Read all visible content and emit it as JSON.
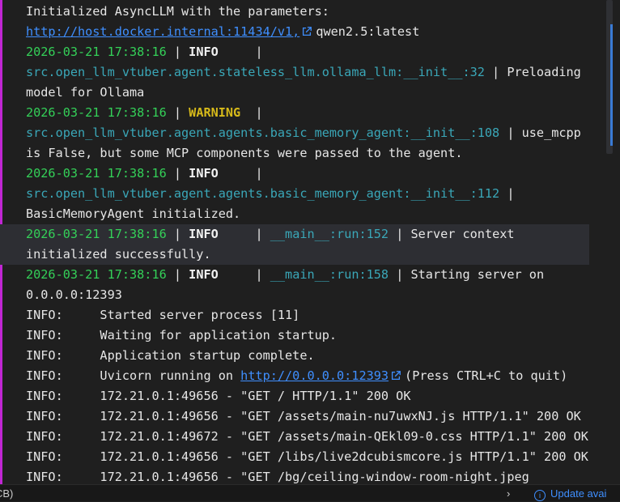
{
  "terminal": {
    "lines": [
      {
        "parts": [
          {
            "t": "text",
            "v": "Initialized AsyncLLM with the parameters:"
          }
        ]
      },
      {
        "parts": [
          {
            "t": "link",
            "v": "http://host.docker.internal:11434/v1,"
          },
          {
            "t": "text",
            "v": "qwen2.5:latest"
          }
        ]
      },
      {
        "parts": [
          {
            "t": "ts",
            "v": "2026-03-21 17:38:16"
          },
          {
            "t": "text",
            "v": " | "
          },
          {
            "t": "info",
            "v": "INFO    "
          },
          {
            "t": "text",
            "v": " |"
          }
        ]
      },
      {
        "parts": [
          {
            "t": "mod",
            "v": "src.open_llm_vtuber.agent.stateless_llm.ollama_llm:__init__:32"
          },
          {
            "t": "text",
            "v": " | Preloading"
          }
        ]
      },
      {
        "parts": [
          {
            "t": "text",
            "v": "model for Ollama"
          }
        ]
      },
      {
        "parts": [
          {
            "t": "ts",
            "v": "2026-03-21 17:38:16"
          },
          {
            "t": "text",
            "v": " | "
          },
          {
            "t": "warn",
            "v": "WARNING "
          },
          {
            "t": "text",
            "v": " |"
          }
        ]
      },
      {
        "parts": [
          {
            "t": "mod",
            "v": "src.open_llm_vtuber.agent.agents.basic_memory_agent:__init__:108"
          },
          {
            "t": "text",
            "v": " | use_mcpp"
          }
        ]
      },
      {
        "parts": [
          {
            "t": "text",
            "v": "is False, but some MCP components were passed to the agent."
          }
        ]
      },
      {
        "parts": [
          {
            "t": "ts",
            "v": "2026-03-21 17:38:16"
          },
          {
            "t": "text",
            "v": " | "
          },
          {
            "t": "info",
            "v": "INFO    "
          },
          {
            "t": "text",
            "v": " |"
          }
        ]
      },
      {
        "parts": [
          {
            "t": "mod",
            "v": "src.open_llm_vtuber.agent.agents.basic_memory_agent:__init__:112"
          },
          {
            "t": "text",
            "v": " |"
          }
        ]
      },
      {
        "parts": [
          {
            "t": "text",
            "v": "BasicMemoryAgent initialized."
          }
        ]
      },
      {
        "hl": true,
        "parts": [
          {
            "t": "ts",
            "v": "2026-03-21 17:38:16"
          },
          {
            "t": "text",
            "v": " | "
          },
          {
            "t": "info",
            "v": "INFO    "
          },
          {
            "t": "text",
            "v": " | "
          },
          {
            "t": "mod",
            "v": "__main__:run:152"
          },
          {
            "t": "text",
            "v": " | Server context"
          }
        ]
      },
      {
        "hl": true,
        "parts": [
          {
            "t": "text",
            "v": "initialized successfully."
          }
        ]
      },
      {
        "parts": [
          {
            "t": "ts",
            "v": "2026-03-21 17:38:16"
          },
          {
            "t": "text",
            "v": " | "
          },
          {
            "t": "info",
            "v": "INFO    "
          },
          {
            "t": "text",
            "v": " | "
          },
          {
            "t": "mod",
            "v": "__main__:run:158"
          },
          {
            "t": "text",
            "v": " | Starting server on"
          }
        ]
      },
      {
        "parts": [
          {
            "t": "text",
            "v": "0.0.0.0:12393"
          }
        ]
      },
      {
        "parts": [
          {
            "t": "text",
            "v": "INFO:     Started server process [11]"
          }
        ]
      },
      {
        "parts": [
          {
            "t": "text",
            "v": "INFO:     Waiting for application startup."
          }
        ]
      },
      {
        "parts": [
          {
            "t": "text",
            "v": "INFO:     Application startup complete."
          }
        ]
      },
      {
        "parts": [
          {
            "t": "text",
            "v": "INFO:     Uvicorn running on "
          },
          {
            "t": "link",
            "v": "http://0.0.0.0:12393"
          },
          {
            "t": "text",
            "v": "(Press CTRL+C to quit)"
          }
        ]
      },
      {
        "parts": [
          {
            "t": "text",
            "v": "INFO:     172.21.0.1:49656 - \"GET / HTTP/1.1\" 200 OK"
          }
        ]
      },
      {
        "parts": [
          {
            "t": "text",
            "v": "INFO:     172.21.0.1:49656 - \"GET /assets/main-nu7uwxNJ.js HTTP/1.1\" 200 OK"
          }
        ]
      },
      {
        "parts": [
          {
            "t": "text",
            "v": "INFO:     172.21.0.1:49672 - \"GET /assets/main-QEkl09-0.css HTTP/1.1\" 200 OK"
          }
        ]
      },
      {
        "parts": [
          {
            "t": "text",
            "v": "INFO:     172.21.0.1:49656 - \"GET /libs/live2dcubismcore.js HTTP/1.1\" 200 OK"
          }
        ]
      },
      {
        "parts": [
          {
            "t": "text",
            "v": "INFO:     172.21.0.1:49656 - \"GET /bg/ceiling-window-room-night.jpeg"
          }
        ]
      }
    ]
  },
  "statusbar": {
    "left_text": "CB)",
    "chevron": "›",
    "update_text": "Update avai"
  },
  "colors": {
    "background": "#1f1f1f",
    "timestamp": "#34d058",
    "info_level": "#f2f2f2",
    "warning_level": "#d7ba1a",
    "module": "#3aa7b8",
    "link": "#3f8fff",
    "accent_bar": "#c026d3"
  },
  "icons": {
    "external_link": "external-link-icon",
    "info": "info-icon",
    "chevron": "chevron-right-icon"
  }
}
